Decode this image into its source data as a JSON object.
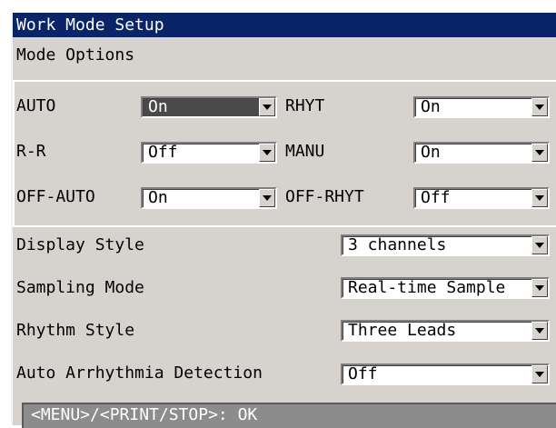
{
  "window": {
    "title": "Work Mode Setup"
  },
  "mode_options": {
    "heading": "Mode Options",
    "rows": [
      {
        "label": "AUTO",
        "value": "On",
        "highlighted": true
      },
      {
        "label": "RHYT",
        "value": "On"
      },
      {
        "label": "R-R",
        "value": "Off"
      },
      {
        "label": "MANU",
        "value": "On"
      },
      {
        "label": "OFF-AUTO",
        "value": "On"
      },
      {
        "label": "OFF-RHYT",
        "value": "Off"
      }
    ]
  },
  "settings": [
    {
      "label": "Display Style",
      "value": "3 channels"
    },
    {
      "label": "Sampling Mode",
      "value": "Real-time Sample"
    },
    {
      "label": "Rhythm Style",
      "value": "Three Leads"
    },
    {
      "label": "Auto Arrhythmia Detection",
      "value": "Off"
    }
  ],
  "status": {
    "text": "<MENU>/<PRINT/STOP>: OK"
  },
  "colors": {
    "titlebar": "#0a2468",
    "panel": "#d6d3ce",
    "highlight_field": "#4a4a4a",
    "status_bar": "#8c8c8c"
  },
  "icons": {
    "dropdown": "chevron-down-icon"
  }
}
